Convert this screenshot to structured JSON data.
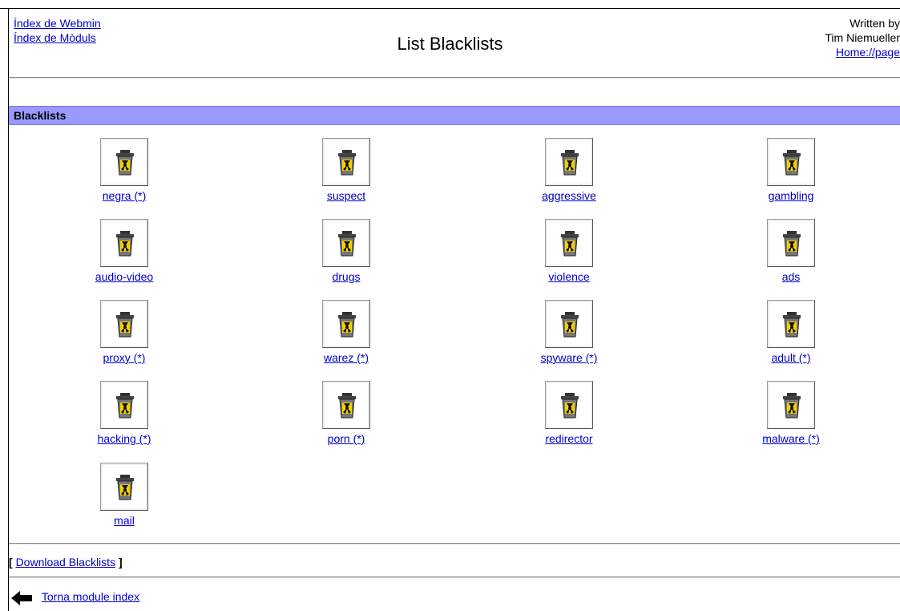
{
  "header": {
    "links": [
      "Índex de Webmin",
      "Índex de Mòduls"
    ],
    "title": "List Blacklists",
    "author_line1": "Written by",
    "author_line2": "Tim Niemueller",
    "home_link": "Home://page"
  },
  "section": {
    "title": "Blacklists"
  },
  "blacklists": [
    "negra (*)",
    "suspect",
    "aggressive",
    "gambling",
    "audio-video",
    "drugs",
    "violence",
    "ads",
    "proxy (*)",
    "warez (*)",
    "spyware (*)",
    "adult (*)",
    "hacking (*)",
    "porn (*)",
    "redirector",
    "malware (*)",
    "mail"
  ],
  "icon": "radioactive-trash-icon",
  "footer": {
    "open_bracket": "[",
    "download_label": "Download Blacklists",
    "close_bracket": "]",
    "back_label": "Torna module index",
    "back_icon": "back-arrow-icon"
  }
}
